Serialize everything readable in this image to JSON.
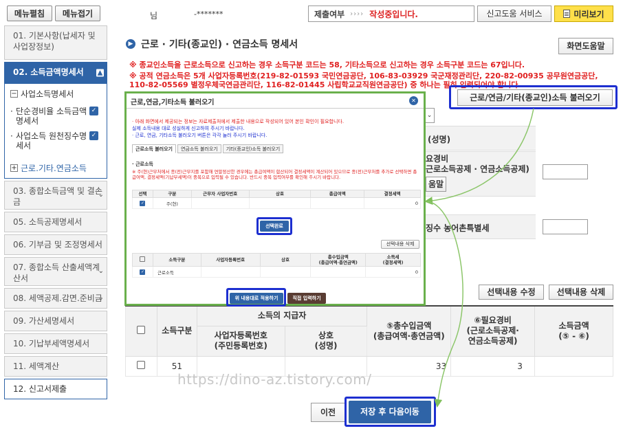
{
  "sidebar": {
    "expand_label": "메뉴펼침",
    "collapse_label": "메뉴접기",
    "items": [
      {
        "label": "01. 기본사항(납세자 및 사업장정보)"
      },
      {
        "label": "02. 소득금액명세서"
      },
      {
        "label": "03. 종합소득금액 및 결손금"
      },
      {
        "label": "05. 소득공제명세서"
      },
      {
        "label": "06. 기부금 및 조정명세서"
      },
      {
        "label": "07. 종합소득 산출세액계산서"
      },
      {
        "label": "08. 세액공제.감면.준비금"
      },
      {
        "label": "09. 가산세명세서"
      },
      {
        "label": "10. 기납부세액명세서"
      },
      {
        "label": "11. 세액계산"
      },
      {
        "label": "12. 신고서제출"
      }
    ],
    "submenu": {
      "group": "사업소득명세서",
      "items": [
        "단순경비율 소득금액명세서",
        "사업소득 원천징수명세서"
      ],
      "footer": "근로.기타.연금소득"
    }
  },
  "topbar": {
    "name_suffix": "님",
    "masked_id": "-*******",
    "status_label": "제출여부",
    "status_arrows": "››››",
    "status_value": "작성중입니다.",
    "help_service": "신고도움 서비스",
    "preview": "미리보기"
  },
  "page": {
    "title": "근로 · 기타(종교인) · 연금소득 명세서",
    "help_button": "화면도움말",
    "notice1": "※ 종교인소득을 근로소득으로 신고하는 경우 소득구분 코드는 58, 기타소득으로 신고하는 경우 소득구분 코드는 67입니다.",
    "notice2": "※ 공적 연금소득은 5개 사업자등록번호(219-82-01593 국민연금공단, 106-83-03929 국군재정관리단, 220-82-00935 공무원연금공단, 110-82-05569 별정우체국연금관리단, 116-82-01445 사립학교교직원연금공단) 중 하나는 필히 입력되어야 합니다.",
    "load_button": "근로/연금/기타(종교인)소득 불러오기",
    "bg_fragments": {
      "f1": "(성명)",
      "f2": "요경비",
      "f3": "근로소득공제 · 연금소득공제)",
      "f4": "움말",
      "f5": "징수 농어촌특별세"
    },
    "edit_button": "선택내용 수정",
    "delete_button": "선택내용 삭제"
  },
  "main_table": {
    "group_header": "소득의 지급자",
    "headers": {
      "type": "소득구분",
      "bizno": "사업자등록번호\n(주민등록번호)",
      "name": "상호\n(성명)",
      "gross": "⑤총수입금액\n(총급여액·총연금액)",
      "expense": "⑥필요경비\n(근로소득공제·\n연금소득공제)",
      "income": "소득금액\n(⑤ - ⑥)"
    },
    "row": {
      "type": "51",
      "gross": "33",
      "expense": "3"
    }
  },
  "watermark": "https://dino-az.tistory.com/",
  "buttons": {
    "prev": "이전",
    "save_next": "저장 후 다음이동"
  },
  "modal": {
    "title": "근로,연금,기타소득 불러오기",
    "notes": [
      "· 아래 화면에서 제공되는 정보는 자료제출처에서 제출한 내용으로 작성되어 있어 본인 확인이 필요합니다.",
      "  실제 소득내용 대로 성실하게 신고하여 주시기 바랍니다.",
      "· 근로, 연금, 기타소득 불러오기 버튼은 각각 눌러 주시기 바랍니다."
    ],
    "tabs": [
      "근로소득 불러오기",
      "연금소득 불러오기",
      "기타(종교인)소득 불러오기"
    ],
    "section": "· 근로소득",
    "warning": "※ 주(현)근무처에서 종(전)근무지를 포함해 연말정산한 경우에는 총급여액이 합산되어 결정세액이 계산되어 있으므로 종(전)근무처를 추가로 선택하면 총급여액, 결정세액(기납부세액)이 중복으로 입력될 수 있습니다. 반드시 중복 입력여부를 확인해 주시기 바랍니다.",
    "table1": {
      "headers": [
        "선택",
        "구분",
        "근무자 사업자번호",
        "상호",
        "총급여액",
        "결정세액"
      ],
      "row": [
        "주(현)",
        "0"
      ]
    },
    "select_done": "선택완료",
    "select_delete": "선택내용 삭제",
    "table2": {
      "headers": [
        "소득구분",
        "사업자등록번호",
        "상호",
        "총수입금액\n(총급여액·총연금액)",
        "소득세\n(결정세액)"
      ],
      "row": [
        "근로소득",
        "0"
      ]
    },
    "apply_button": "위 내용대로 적용하기",
    "manual_button": "직접 입력하기"
  }
}
